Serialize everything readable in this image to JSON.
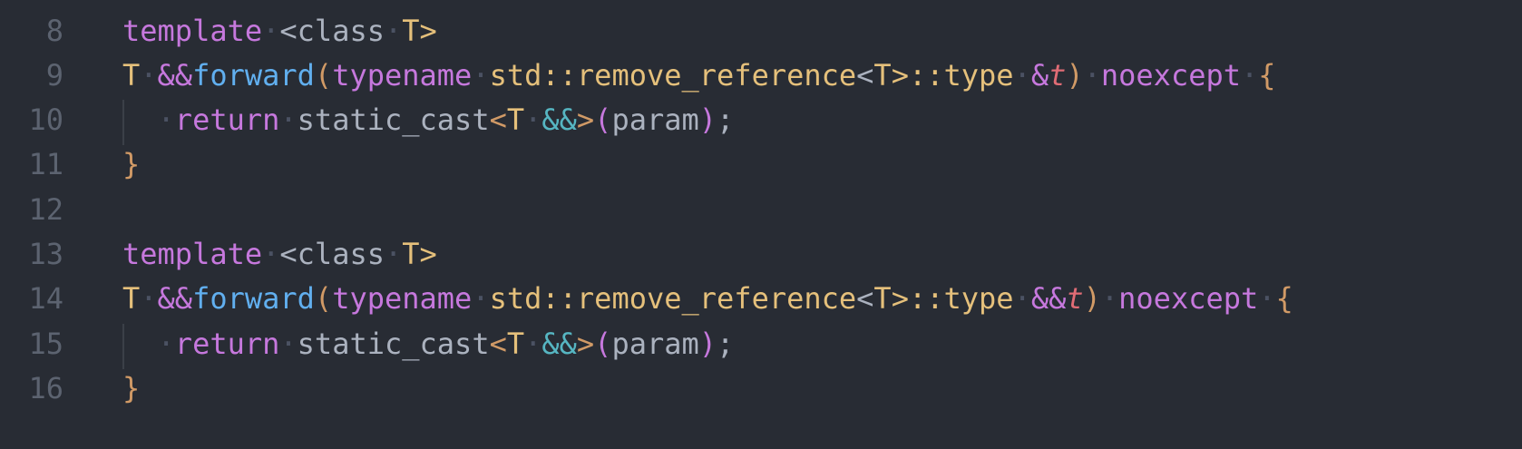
{
  "editor": {
    "line_numbers": [
      "8",
      "9",
      "10",
      "11",
      "12",
      "13",
      "14",
      "15",
      "16"
    ],
    "line8": {
      "kw_template": "template",
      "ws1": "·",
      "angle_open_class": "<class",
      "ws2": "·",
      "t_close": "T>"
    },
    "line9": {
      "t": "T",
      "ws1": "·",
      "amp": "&&",
      "forward": "forward",
      "paren_open": "(",
      "typename": "typename",
      "ws2": "·",
      "std_remove": "std::remove_reference",
      "lt": "<",
      "t2": "T",
      "gt_type": ">::type",
      "ws3": "·",
      "param_amp": "&",
      "param_t": "t",
      "paren_close": ")",
      "ws4": "·",
      "noexcept": "noexcept",
      "ws5": "·",
      "brace": "{"
    },
    "line10": {
      "ws_indent": "·",
      "kw_return": "return",
      "ws1": "·",
      "static_cast": "static_cast",
      "lt": "<",
      "t": "T",
      "ws2": "·",
      "amp": "&&",
      "gt": ">",
      "paren_open": "(",
      "param": "param",
      "paren_close": ")",
      "semi": ";"
    },
    "line11": {
      "brace": "}"
    },
    "line13": {
      "kw_template": "template",
      "ws1": "·",
      "angle_open_class": "<class",
      "ws2": "·",
      "t_close": "T>"
    },
    "line14": {
      "t": "T",
      "ws1": "·",
      "amp": "&&",
      "forward": "forward",
      "paren_open": "(",
      "typename": "typename",
      "ws2": "·",
      "std_remove": "std::remove_reference",
      "lt": "<",
      "t2": "T",
      "gt_type": ">::type",
      "ws3": "·",
      "param_amp": "&&",
      "param_t": "t",
      "paren_close": ")",
      "ws4": "·",
      "noexcept": "noexcept",
      "ws5": "·",
      "brace": "{"
    },
    "line15": {
      "ws_indent": "·",
      "kw_return": "return",
      "ws1": "·",
      "static_cast": "static_cast",
      "lt": "<",
      "t": "T",
      "ws2": "·",
      "amp": "&&",
      "gt": ">",
      "paren_open": "(",
      "param": "param",
      "paren_close": ")",
      "semi": ";"
    },
    "line16": {
      "brace": "}"
    }
  },
  "theme": {
    "background": "#282c34",
    "line_number": "#5c6370",
    "keyword": "#c678dd",
    "type": "#e5c07b",
    "operator": "#56b6c2",
    "function": "#61afef",
    "parameter": "#e06c75",
    "bracket": "#d19a66",
    "text": "#abb2bf"
  }
}
